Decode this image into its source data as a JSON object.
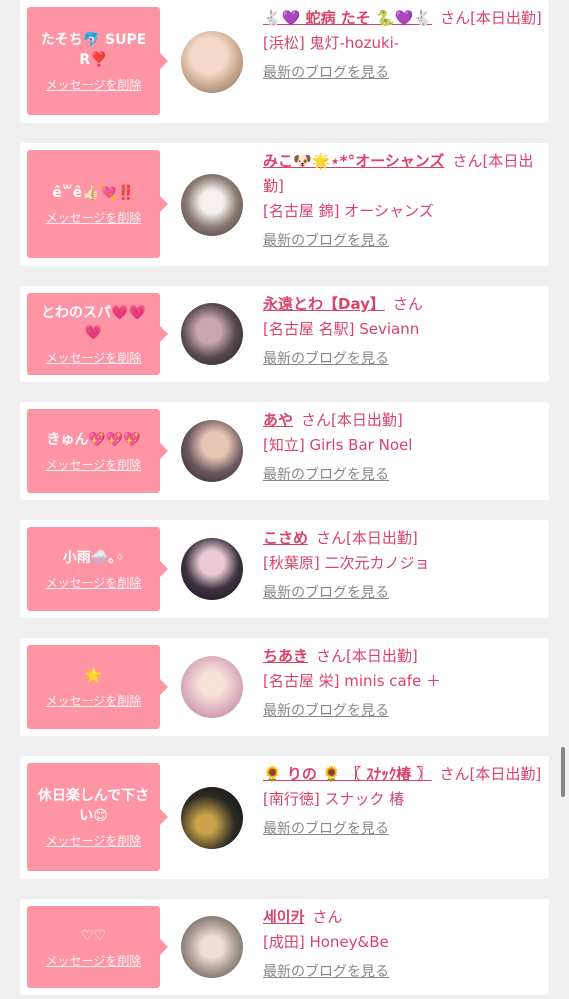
{
  "common": {
    "delete_label": "メッセージを削除",
    "blog_label": "最新のブログを見る",
    "san": "さん"
  },
  "entries": [
    {
      "message": "たそち🐬 SUPER❣️",
      "name": "🐇💜 蛇病 たそ 🐍💜🐇",
      "status": "[本日出勤]",
      "shop": "[浜松] 鬼灯-hozuki-",
      "avatar_color": "#c9a88e"
    },
    {
      "message": "ê꒳ê👍🏻💘‼️",
      "name": "みこ🐶🌟⋆*°オーシャンズ",
      "status": "[本日出勤]",
      "shop": "[名古屋 錦] オーシャンズ",
      "avatar_color": "#8b7c74"
    },
    {
      "message": "とわのスパ💗💗💗",
      "name": "永遠とわ【Day】",
      "status": "",
      "shop": "[名古屋 名駅] Seviann",
      "avatar_color": "#5a4a52"
    },
    {
      "message": "きゅん💖💖💖",
      "name": "あや",
      "status": "[本日出勤]",
      "shop": "[知立] Girls Bar Noel",
      "avatar_color": "#6d5a60"
    },
    {
      "message": "小雨🌨️｡◦",
      "name": "こさめ",
      "status": "[本日出勤]",
      "shop": "[秋葉原] 二次元カノジョ",
      "avatar_color": "#3e3440"
    },
    {
      "message": "🌟",
      "name": "ちあき",
      "status": "[本日出勤]",
      "shop": "[名古屋 栄] minis cafe ＋",
      "avatar_color": "#e0b5c4"
    },
    {
      "message": "休日楽しんで下さい😊",
      "name": "🌻 りの 🌻 〖 ｽﾅｯｸ椿 〗",
      "status": "[本日出勤]",
      "shop": "[南行徳] スナック 椿",
      "avatar_color": "#2c2a24"
    },
    {
      "message": "♡♡",
      "name": "세이카",
      "status": "",
      "shop": "[成田] Honey&Be",
      "avatar_color": "#a89a90"
    }
  ]
}
